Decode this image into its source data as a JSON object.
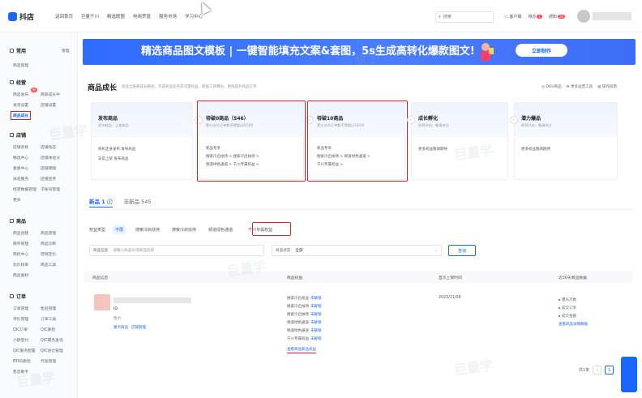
{
  "brand": {
    "name": "抖店",
    "accent": "#1966ff",
    "highlight": "#e02020"
  },
  "topnav": [
    "返回首页",
    "巨量千川",
    "精选联盟",
    "电商罗盘",
    "服务市场",
    "学习中心"
  ],
  "search": {
    "placeholder": "搜索"
  },
  "topright": {
    "service": "客户端",
    "tasks": "待办",
    "tasks_badge": "1",
    "notice": "通知",
    "notice_badge": "20"
  },
  "sidebar": {
    "sections": [
      {
        "title": "常用",
        "right": "管理",
        "items": [
          "商品管理"
        ]
      },
      {
        "title": "经营",
        "items": [
          "商品发布",
          "商家成长中",
          "发货设置",
          "店铺设置",
          "商品成长"
        ]
      },
      {
        "title": "店铺",
        "items": [
          "店铺装修",
          "店铺动态",
          "精选中心",
          "店铺体验分",
          "素质中心",
          "店铺保障",
          "体验服务",
          "店铺宣传",
          "经营数据管理",
          "子账号管理",
          "更多"
        ]
      },
      {
        "title": "商品",
        "items": [
          "商品创建",
          "商品管理",
          "库存管理",
          "商品诊断",
          "商机中心",
          "营销定价",
          "优价榜单",
          "商品工具",
          "商品素材"
        ]
      },
      {
        "title": "订单",
        "items": [
          "订单管理",
          "售后管理",
          "评价管理",
          "订单工具",
          "QIC订单",
          "QIC质检",
          "小额垫付",
          "QIC服务查询",
          "QIC服务配置",
          "QIC进仓管理",
          "BTAS质检",
          "代发管理",
          "售后助手"
        ]
      }
    ],
    "new_badge": "新"
  },
  "banner": {
    "title": "精选商品图文模板 | 一键智能填充文案&套图，5s生成高转化爆款图文!",
    "button": "立即制作"
  },
  "growth": {
    "title": "商品成长",
    "desc": "商品全链路成长路径，完成商品任务获流量权益，赋能工具曝光，更快提升商品订单",
    "links": [
      "DOU商品",
      "更多运营工具",
      "操作指南"
    ],
    "stages": [
      {
        "name": "发布商品",
        "desc": "发布商品，上架商品",
        "lines": [
          "商机走身发布 发布商品",
          "日常上架 发布商品"
        ]
      },
      {
        "name": "待破0商品（546）",
        "desc": "累计支付订单数不得超过0/500",
        "lines": [
          "新品专享",
          "搜索冷启扶持 >   搜索冷启扶持 >",
          "频道绿色通道 >   千川专属权益 >"
        ]
      },
      {
        "name": "待破10商品",
        "desc": "累计支付订单数不得超过10/30",
        "lines": [
          "新品专享",
          "搜索冷启扶持 >   频道绿色通道 >",
          "千川专属权益 >"
        ]
      },
      {
        "name": "成长孵化",
        "desc": "即将开启，敬请关注",
        "lines": [
          "更多权益敬请期待"
        ]
      },
      {
        "name": "潜力爆品",
        "desc": "即将开启，敬请关注",
        "lines": [
          "更多权益敬请期待"
        ]
      }
    ]
  },
  "tabs": [
    {
      "label": "新品 1 ⓘ",
      "active": true
    },
    {
      "label": "非新品 545",
      "active": false
    }
  ],
  "filter": {
    "label": "权益类型",
    "chips": [
      "不限",
      "搜索冷启扶持",
      "搜索冷启扶持",
      "频道绿色通道",
      "千川专属权益"
    ],
    "active": 0
  },
  "fields": {
    "product": {
      "label": "商品信息",
      "placeholder": "请输入商品ID或商品名称"
    },
    "type": {
      "label": "商品状态",
      "value": "全部"
    },
    "query": "查询"
  },
  "table": {
    "headers": [
      "商品信息",
      "商品权益",
      "首次上架时间",
      "近30天商品数据"
    ],
    "row": {
      "id": "ID:",
      "price": "售价",
      "links": [
        "重点商品",
        "店铺管理"
      ],
      "rights": [
        {
          "name": "搜索冷启权益",
          "state": "未解锁"
        },
        {
          "name": "搜索冷启扶持",
          "state": "未解锁"
        },
        {
          "name": "搜索冷启扶持",
          "state": "未解锁"
        },
        {
          "name": "频道绿色通道",
          "state": "未解锁"
        },
        {
          "name": "频道绿色通道",
          "state": "未解锁"
        },
        {
          "name": "千川专属权益",
          "state": "未解锁"
        }
      ],
      "rights_more": "查看商品新品权益",
      "first_listed": "2023/11/06",
      "stats": [
        "曝光次数",
        "成交订单",
        "成交金额"
      ],
      "stats_more": "查看商品详情数据"
    }
  },
  "pager": {
    "total": "共1条",
    "page": "1"
  },
  "watermark": "巨量学"
}
